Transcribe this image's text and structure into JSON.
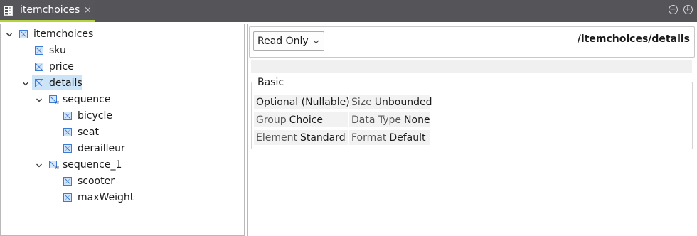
{
  "editor_tab": {
    "title": "itemchoices",
    "close_glyph": "×"
  },
  "window_buttons": {
    "minimize_glyph": "−",
    "maximize_glyph": "+"
  },
  "tree": {
    "nodes": [
      {
        "label": "itemchoices",
        "icon": "element-icon",
        "expanded": true
      },
      {
        "label": "sku",
        "icon": "element-icon"
      },
      {
        "label": "price",
        "icon": "element-icon"
      },
      {
        "label": "details",
        "icon": "element-icon",
        "expanded": true,
        "selected": true
      },
      {
        "label": "sequence",
        "icon": "model-group-icon",
        "expanded": true
      },
      {
        "label": "bicycle",
        "icon": "element-icon"
      },
      {
        "label": "seat",
        "icon": "element-icon"
      },
      {
        "label": "derailleur",
        "icon": "element-icon"
      },
      {
        "label": "sequence_1",
        "icon": "model-group-icon",
        "expanded": true
      },
      {
        "label": "scooter",
        "icon": "element-icon"
      },
      {
        "label": "maxWeight",
        "icon": "element-icon"
      }
    ]
  },
  "details": {
    "mode_value": "Read Only",
    "path": "/itemchoices/details",
    "group_title": "Basic",
    "props": [
      {
        "key": "Optional (Nullable)",
        "value": ""
      },
      {
        "key": "Size",
        "value": "Unbounded"
      },
      {
        "key": "Group",
        "value": "Choice"
      },
      {
        "key": "Data Type",
        "value": "None"
      },
      {
        "key": "Element",
        "value": "Standard"
      },
      {
        "key": "Format",
        "value": "Default"
      }
    ]
  },
  "colors": {
    "tab_bar": "#555559",
    "tab_underline": "#b5d33a",
    "selection": "#cce4f7",
    "icon_blue": "#3b7bd4"
  }
}
